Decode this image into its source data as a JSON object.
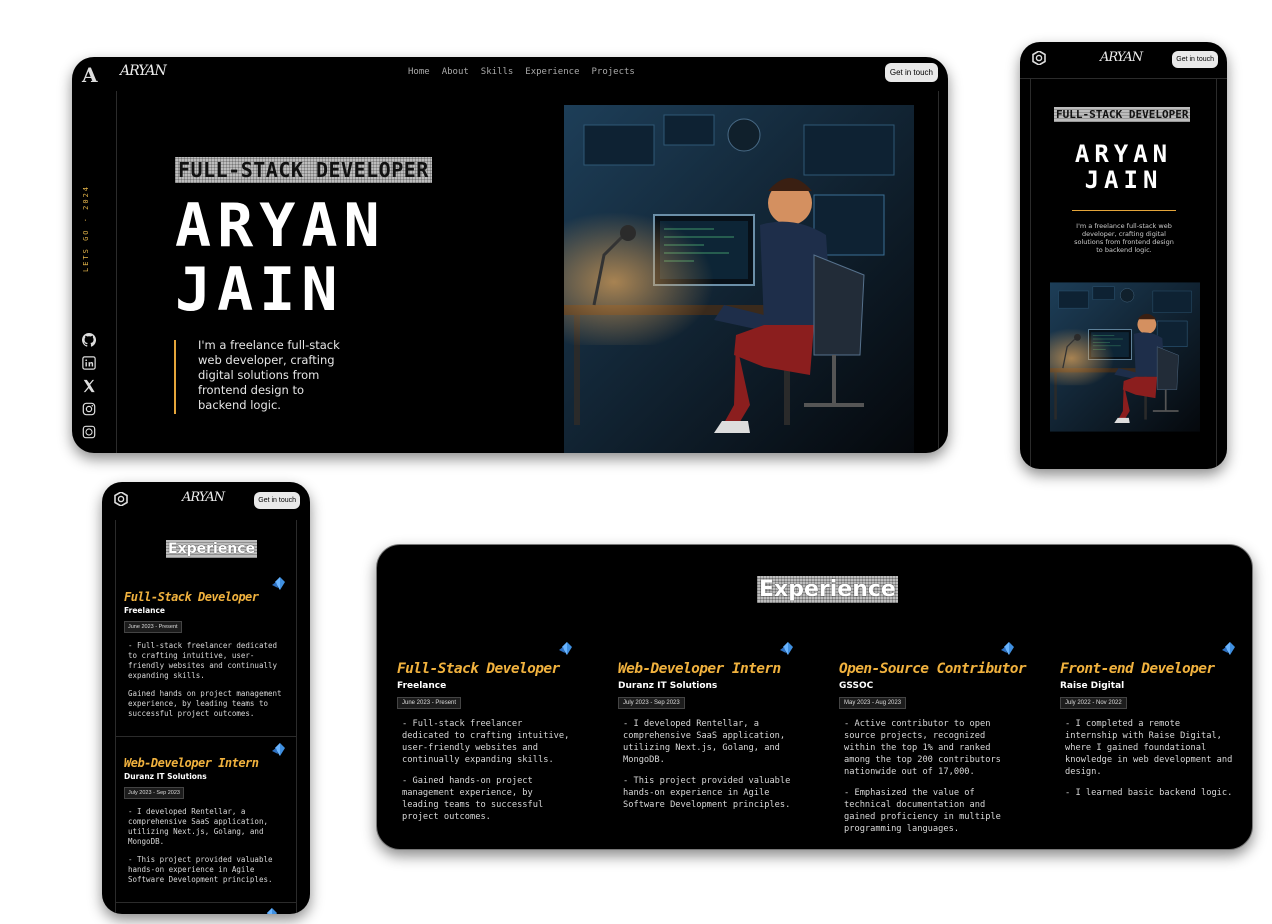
{
  "brand": {
    "logo_letter": "A",
    "signature": "ARYAN"
  },
  "nav": {
    "items": [
      "Home",
      "About",
      "Skills",
      "Experience",
      "Projects"
    ]
  },
  "cta_label": "Get in touch",
  "hero": {
    "vertical_text": "LETS GO · 2024",
    "badge": "FULL-STACK DEVELOPER",
    "name_line1": "ARYAN",
    "name_line2": "JAIN",
    "bio": "I'm a freelance full-stack web developer, crafting digital solutions from frontend design to backend logic.",
    "socials": [
      "github-icon",
      "linkedin-icon",
      "x-icon",
      "instagram-icon",
      "whatsapp-icon"
    ]
  },
  "experience": {
    "heading": "Experience",
    "items": [
      {
        "role": "Full-Stack Developer",
        "company": "Freelance",
        "date": "June 2023 - Present",
        "points": [
          "- Full-stack freelancer dedicated to crafting intuitive, user-friendly websites and continually expanding skills.",
          "- Gained hands-on project management experience, by leading teams to successful project outcomes."
        ]
      },
      {
        "role": "Web-Developer Intern",
        "company": "Duranz IT Solutions",
        "date": "July 2023 - Sep 2023",
        "points": [
          "- I developed Rentellar, a comprehensive SaaS application, utilizing Next.js, Golang, and MongoDB.",
          "- This project provided valuable hands-on experience in Agile Software Development principles."
        ]
      },
      {
        "role": "Open-Source Contributor",
        "company": "GSSOC",
        "date": "May 2023 - Aug 2023",
        "points": [
          "- Active contributor to open source projects, recognized within the top 1% and ranked among the top 200 contributors nationwide out of 17,000.",
          "- Emphasized the value of technical documentation and gained proficiency in multiple programming languages."
        ]
      },
      {
        "role": "Front-end Developer",
        "company": "Raise Digital",
        "date": "July 2022 - Nov 2022",
        "points": [
          "- I completed a remote internship with Raise Digital, where I gained foundational knowledge in web development and design.",
          "- I learned basic backend logic."
        ]
      }
    ]
  },
  "mobile_experience": {
    "item1_point2": "Gained hands on project management experience, by leading teams to successful project outcomes."
  },
  "colors": {
    "accent": "#f1b23e",
    "background": "#000000",
    "gold_line": "#e4a53a",
    "badge_bg": "#bdbdbd"
  }
}
